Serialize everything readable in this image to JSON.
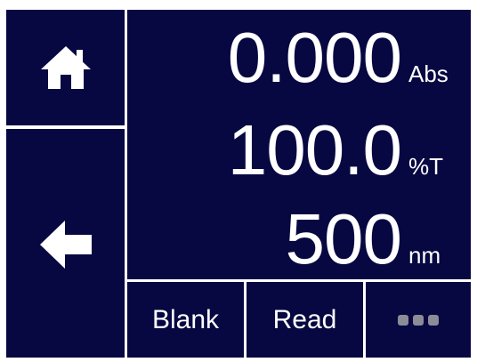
{
  "sidebar": {
    "home_icon": "home-icon",
    "back_icon": "arrow-left-icon"
  },
  "readout": {
    "absorbance": {
      "value": "0.000",
      "unit": "Abs"
    },
    "transmittance": {
      "value": "100.0",
      "unit": "%T"
    },
    "wavelength": {
      "value": "500",
      "unit": "nm"
    }
  },
  "buttons": {
    "blank_label": "Blank",
    "read_label": "Read",
    "more_icon": "more-dots-icon"
  },
  "colors": {
    "panel": "#070841",
    "text": "#ffffff",
    "dots": "#8c8c99",
    "divider": "#ffffff"
  }
}
